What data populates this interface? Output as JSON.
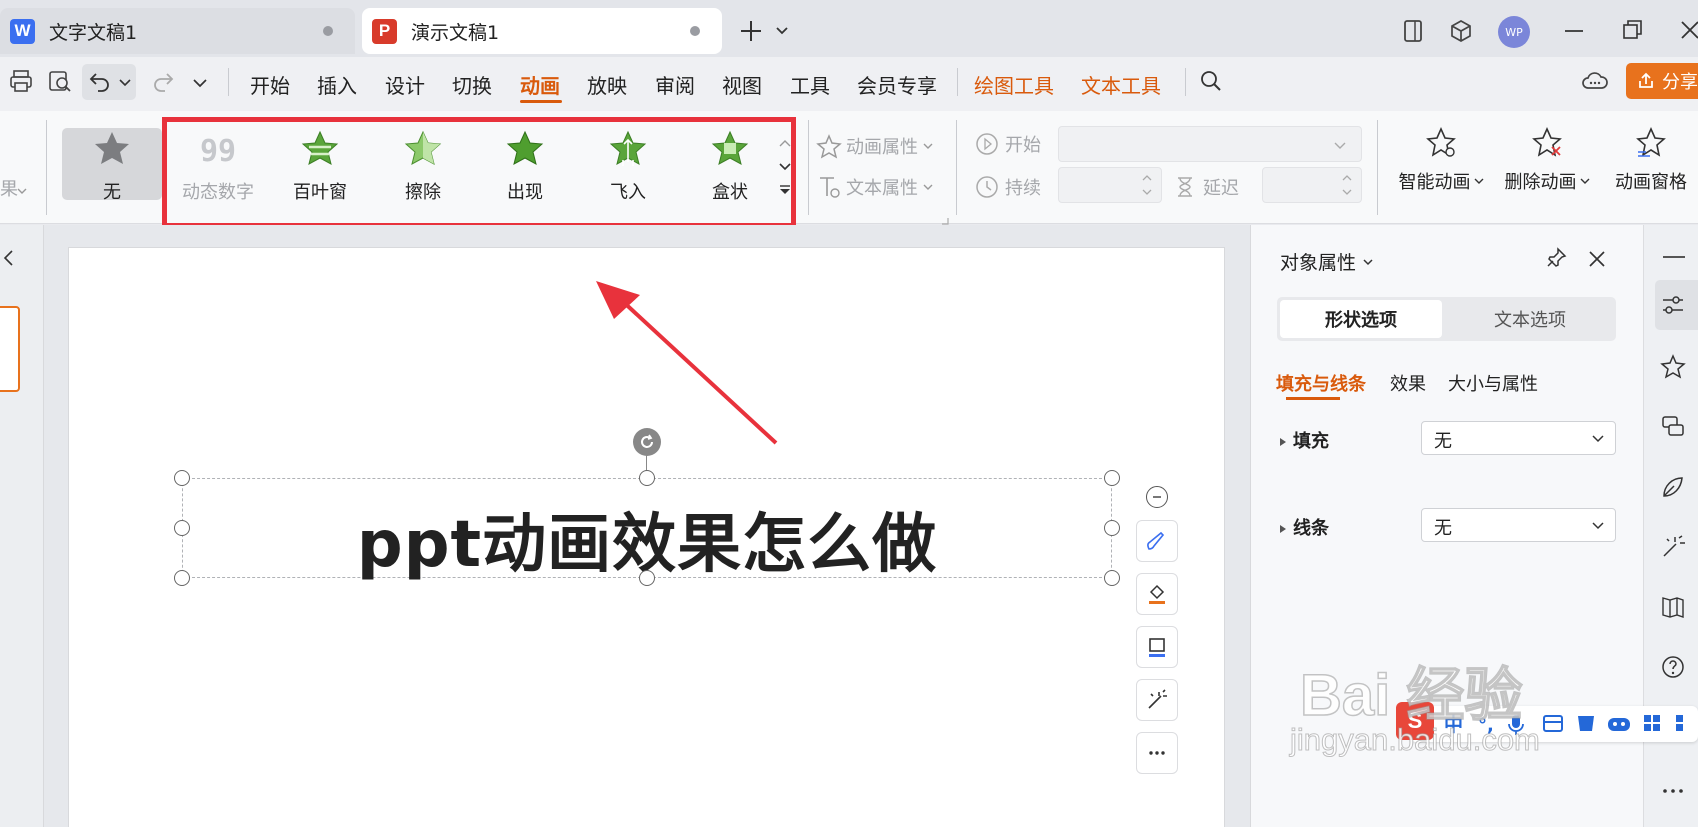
{
  "tabs": [
    {
      "app_icon": "W",
      "label": "文字文稿1",
      "color": "#3b6ff0"
    },
    {
      "app_icon": "P",
      "label": "演示文稿1",
      "color": "#d83b2b"
    }
  ],
  "window": {
    "avatar": "WP",
    "share_label": "分享"
  },
  "menu": {
    "items": [
      "开始",
      "插入",
      "设计",
      "切换",
      "动画",
      "放映",
      "审阅",
      "视图",
      "工具",
      "会员专享"
    ],
    "active": "动画",
    "context_items": [
      "绘图工具",
      "文本工具"
    ]
  },
  "ribbon": {
    "left_partial": "果",
    "effects": [
      {
        "label": "无",
        "icon": "star-gray-icon"
      },
      {
        "label": "动态数字",
        "icon": "digits-icon"
      },
      {
        "label": "百叶窗",
        "icon": "star-blinds-icon"
      },
      {
        "label": "擦除",
        "icon": "star-wipe-icon"
      },
      {
        "label": "出现",
        "icon": "star-appear-icon"
      },
      {
        "label": "飞入",
        "icon": "star-flyin-icon"
      },
      {
        "label": "盒状",
        "icon": "star-box-icon"
      }
    ],
    "anim_props": "动画属性",
    "text_props": "文本属性",
    "start_label": "开始",
    "duration_label": "持续",
    "delay_label": "延迟",
    "smart_anim": "智能动画",
    "delete_anim": "删除动画",
    "anim_pane": "动画窗格"
  },
  "slide": {
    "title": "ppt动画效果怎么做"
  },
  "panel": {
    "title": "对象属性",
    "seg_shape": "形状选项",
    "seg_text": "文本选项",
    "subtabs": [
      "填充与线条",
      "效果",
      "大小与属性"
    ],
    "fill_label": "填充",
    "fill_value": "无",
    "line_label": "线条",
    "line_value": "无"
  },
  "watermark": {
    "brand": "Bai 经验",
    "url": "jingyan.baidu.com"
  },
  "colors": {
    "accent": "#d95a0c",
    "highlight": "#e8323c",
    "star_green": "#5aa53a"
  }
}
